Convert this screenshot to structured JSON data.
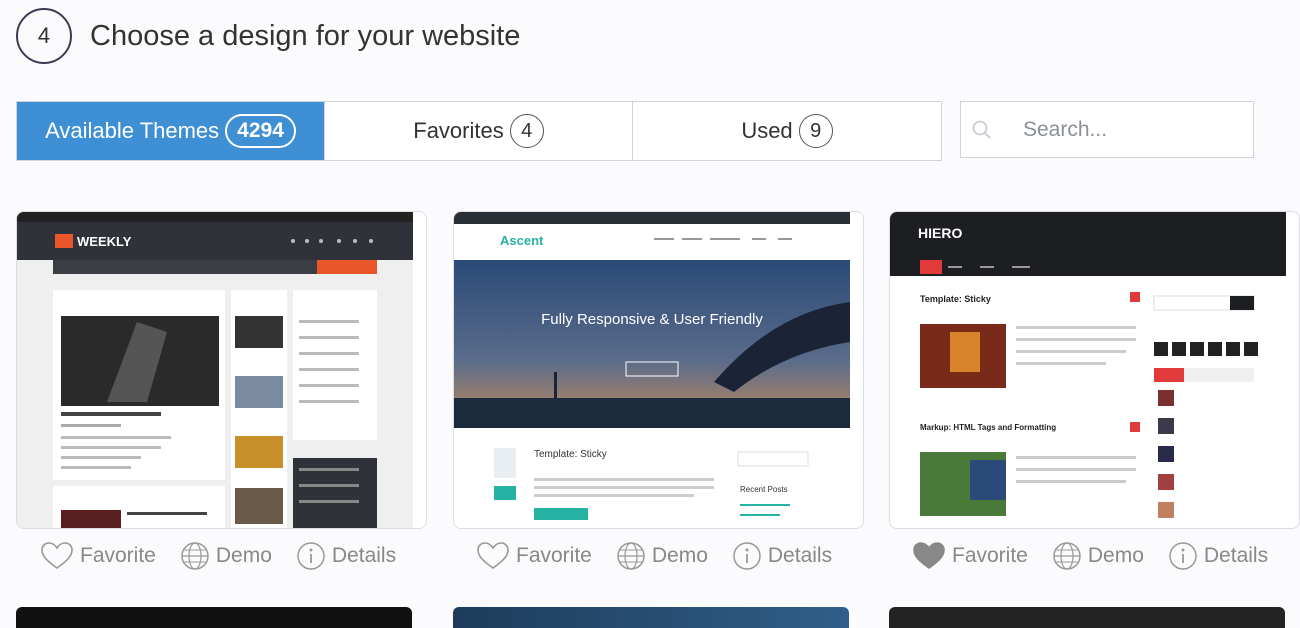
{
  "step": {
    "number": "4",
    "title": "Choose a design for your website"
  },
  "tabs": [
    {
      "label": "Available Themes",
      "count": "4294"
    },
    {
      "label": "Favorites",
      "count": "4"
    },
    {
      "label": "Used",
      "count": "9"
    }
  ],
  "search": {
    "placeholder": "Search..."
  },
  "themes": [
    {
      "name": "WEEKLY",
      "actions": {
        "favorite": "Favorite",
        "demo": "Demo",
        "details": "Details"
      },
      "favorited": false,
      "preview": {
        "logo": "WEEKLY"
      }
    },
    {
      "name": "Ascent",
      "actions": {
        "favorite": "Favorite",
        "demo": "Demo",
        "details": "Details"
      },
      "favorited": false,
      "preview": {
        "logo": "Ascent",
        "hero_text": "Fully Responsive & User Friendly",
        "post_title": "Template: Sticky",
        "sidebar_heading": "Recent Posts"
      }
    },
    {
      "name": "HIERO",
      "actions": {
        "favorite": "Favorite",
        "demo": "Demo",
        "details": "Details"
      },
      "favorited": true,
      "preview": {
        "logo": "HIERO",
        "post_title": "Template: Sticky",
        "post_title_2": "Markup: HTML Tags and Formatting"
      }
    }
  ],
  "colors": {
    "accent": "#3f8fd4",
    "weekly_orange": "#e8562a",
    "ascent_teal": "#26b3a3",
    "hiero_red": "#e03a3a"
  },
  "icons": {
    "favorite": "heart-icon",
    "demo": "globe-icon",
    "details": "info-icon",
    "search": "search-icon"
  }
}
